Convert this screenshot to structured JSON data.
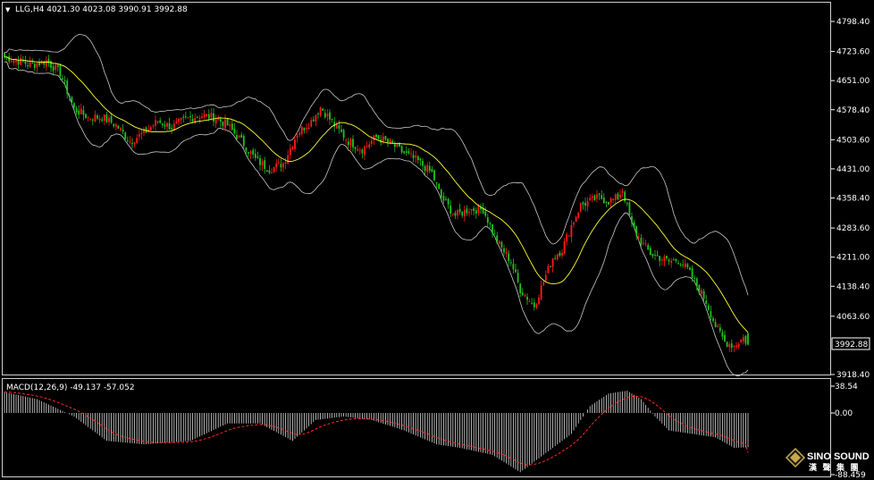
{
  "header": {
    "arrow": "▼",
    "symbol_line": "LLG,H4  4021.30 4023.08 3990.91 3992.88"
  },
  "macd_header": "MACD(12,26,9) -49.137 -57.052",
  "price_axis": {
    "ticks": [
      "4798.40",
      "4723.60",
      "4651.00",
      "4578.40",
      "4503.60",
      "4431.00",
      "4358.40",
      "4283.60",
      "4211.00",
      "4138.40",
      "4063.60",
      "3918.40"
    ],
    "current_price_label": "3992.88"
  },
  "macd_axis": {
    "ticks": [
      "38.54",
      "0.00",
      "-88.459"
    ]
  },
  "logo": {
    "name": "SINO SOUND",
    "sub": "漢 聲 集 團"
  },
  "colors": {
    "up": "#ff1b1b",
    "down": "#22c322",
    "ma": "#ffff33",
    "bands": "#c8c8c8",
    "signal": "#ff2a2a",
    "hist": "#dddddd",
    "frame": "#d0d0d0"
  },
  "chart_data": [
    {
      "type": "candlestick",
      "title": "LLG,H4",
      "overlays": [
        "Bollinger Bands",
        "moving average"
      ],
      "ylim": [
        3918.4,
        4798.4
      ],
      "anchors_close": [
        [
          0,
          4710
        ],
        [
          6,
          4700
        ],
        [
          12,
          4690
        ],
        [
          18,
          4700
        ],
        [
          24,
          4670
        ],
        [
          30,
          4580
        ],
        [
          36,
          4560
        ],
        [
          42,
          4560
        ],
        [
          48,
          4540
        ],
        [
          54,
          4500
        ],
        [
          60,
          4520
        ],
        [
          66,
          4550
        ],
        [
          72,
          4535
        ],
        [
          78,
          4555
        ],
        [
          84,
          4565
        ],
        [
          90,
          4560
        ],
        [
          96,
          4540
        ],
        [
          102,
          4500
        ],
        [
          108,
          4455
        ],
        [
          114,
          4430
        ],
        [
          120,
          4445
        ],
        [
          126,
          4520
        ],
        [
          132,
          4550
        ],
        [
          136,
          4585
        ],
        [
          142,
          4540
        ],
        [
          148,
          4500
        ],
        [
          154,
          4480
        ],
        [
          160,
          4510
        ],
        [
          166,
          4495
        ],
        [
          172,
          4470
        ],
        [
          178,
          4450
        ],
        [
          184,
          4420
        ],
        [
          188,
          4360
        ],
        [
          194,
          4315
        ],
        [
          200,
          4330
        ],
        [
          206,
          4330
        ],
        [
          212,
          4250
        ],
        [
          218,
          4200
        ],
        [
          222,
          4130
        ],
        [
          228,
          4090
        ],
        [
          232,
          4150
        ],
        [
          236,
          4210
        ],
        [
          240,
          4230
        ],
        [
          244,
          4290
        ],
        [
          248,
          4340
        ],
        [
          252,
          4350
        ],
        [
          256,
          4360
        ],
        [
          260,
          4350
        ],
        [
          264,
          4360
        ],
        [
          266,
          4380
        ],
        [
          270,
          4290
        ],
        [
          274,
          4250
        ],
        [
          278,
          4220
        ],
        [
          282,
          4210
        ],
        [
          286,
          4200
        ],
        [
          290,
          4205
        ],
        [
          294,
          4180
        ],
        [
          298,
          4140
        ],
        [
          302,
          4100
        ],
        [
          306,
          4040
        ],
        [
          310,
          4000
        ],
        [
          314,
          3990
        ],
        [
          318,
          4010
        ],
        [
          320,
          3993
        ]
      ],
      "last_candle": {
        "open": 4021.3,
        "high": 4023.08,
        "low": 3990.91,
        "close": 3992.88
      }
    },
    {
      "type": "histogram",
      "title": "MACD(12,26,9)",
      "macd": -49.137,
      "signal": -57.052,
      "ylim": [
        -88.459,
        38.54
      ],
      "anchors_macd": [
        [
          0,
          30
        ],
        [
          14,
          20
        ],
        [
          30,
          -5
        ],
        [
          44,
          -40
        ],
        [
          60,
          -45
        ],
        [
          80,
          -40
        ],
        [
          96,
          -15
        ],
        [
          110,
          -15
        ],
        [
          124,
          -40
        ],
        [
          134,
          -10
        ],
        [
          146,
          -5
        ],
        [
          158,
          -10
        ],
        [
          172,
          -25
        ],
        [
          186,
          -45
        ],
        [
          196,
          -50
        ],
        [
          210,
          -60
        ],
        [
          222,
          -85
        ],
        [
          232,
          -60
        ],
        [
          244,
          -30
        ],
        [
          252,
          10
        ],
        [
          260,
          28
        ],
        [
          268,
          32
        ],
        [
          274,
          20
        ],
        [
          280,
          -5
        ],
        [
          286,
          -25
        ],
        [
          296,
          -30
        ],
        [
          306,
          -35
        ],
        [
          314,
          -50
        ],
        [
          320,
          -49.137
        ]
      ]
    }
  ]
}
